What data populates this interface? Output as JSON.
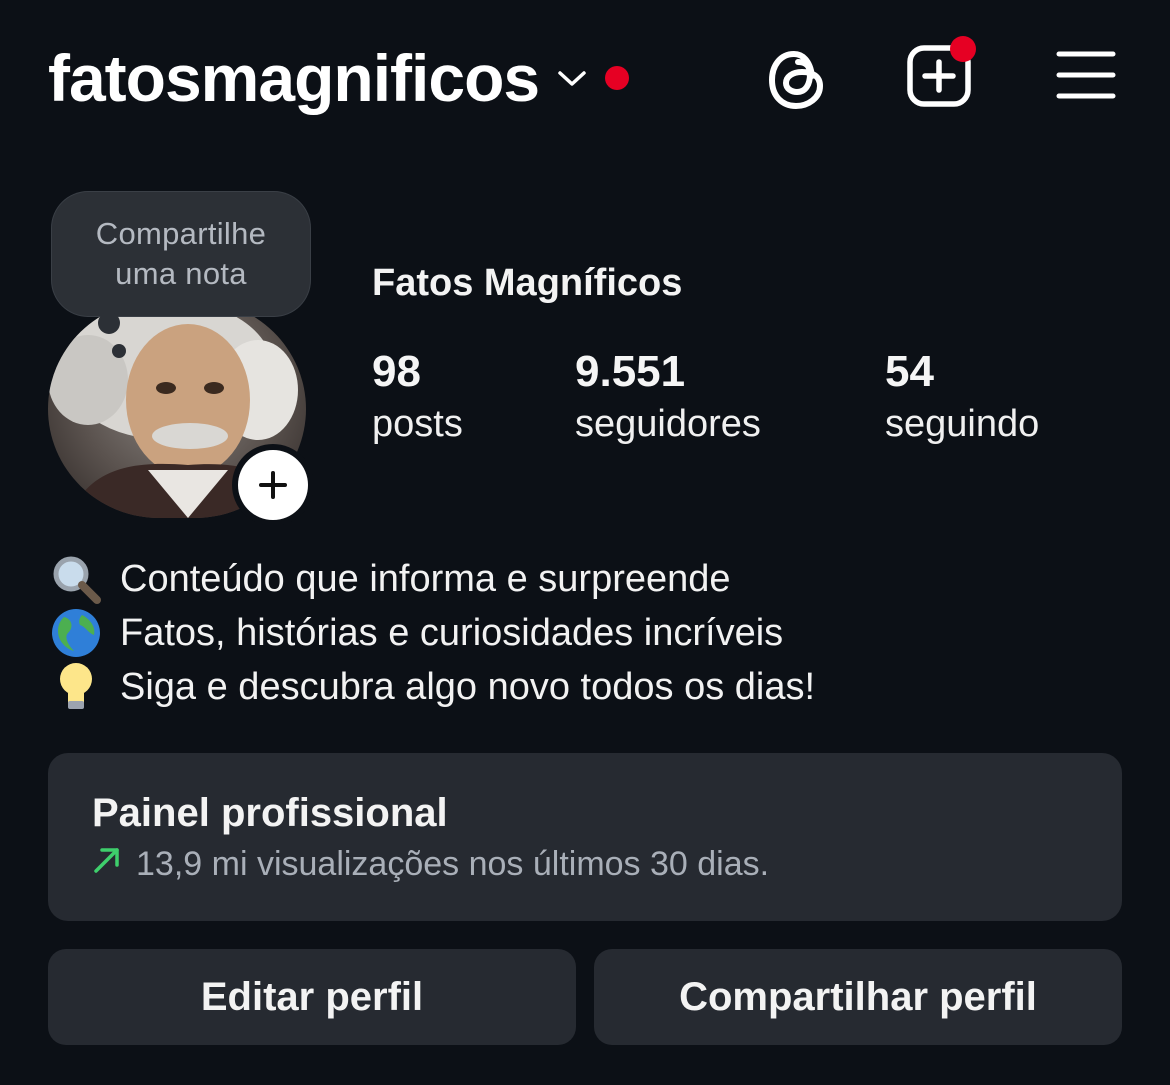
{
  "header": {
    "username": "fatosmagnificos",
    "notification_dot_color": "#e60023"
  },
  "icons": {
    "account_switch": "chevron-down-icon",
    "threads": "threads-icon",
    "create": "plus-square-icon",
    "menu": "hamburger-menu-icon"
  },
  "profile": {
    "note_line1": "Compartilhe",
    "note_line2": "uma nota",
    "display_name": "Fatos Magníficos",
    "stats": {
      "posts": {
        "value": "98",
        "label": "posts"
      },
      "followers": {
        "value": "9.551",
        "label": "seguidores"
      },
      "following": {
        "value": "54",
        "label": "seguindo"
      }
    },
    "bio": [
      {
        "emoji": "🔍",
        "text": "Conteúdo que informa e surpreende"
      },
      {
        "emoji": "🌎",
        "text": "Fatos, histórias e curiosidades incríveis"
      },
      {
        "emoji": "💡",
        "text": "Siga e descubra algo novo todos os dias!"
      }
    ]
  },
  "dashboard": {
    "title": "Painel profissional",
    "subtitle": "13,9 mi visualizações nos últimos 30 dias.",
    "trend_color": "#3ecf6c"
  },
  "buttons": {
    "edit": "Editar perfil",
    "share": "Compartilhar perfil"
  }
}
